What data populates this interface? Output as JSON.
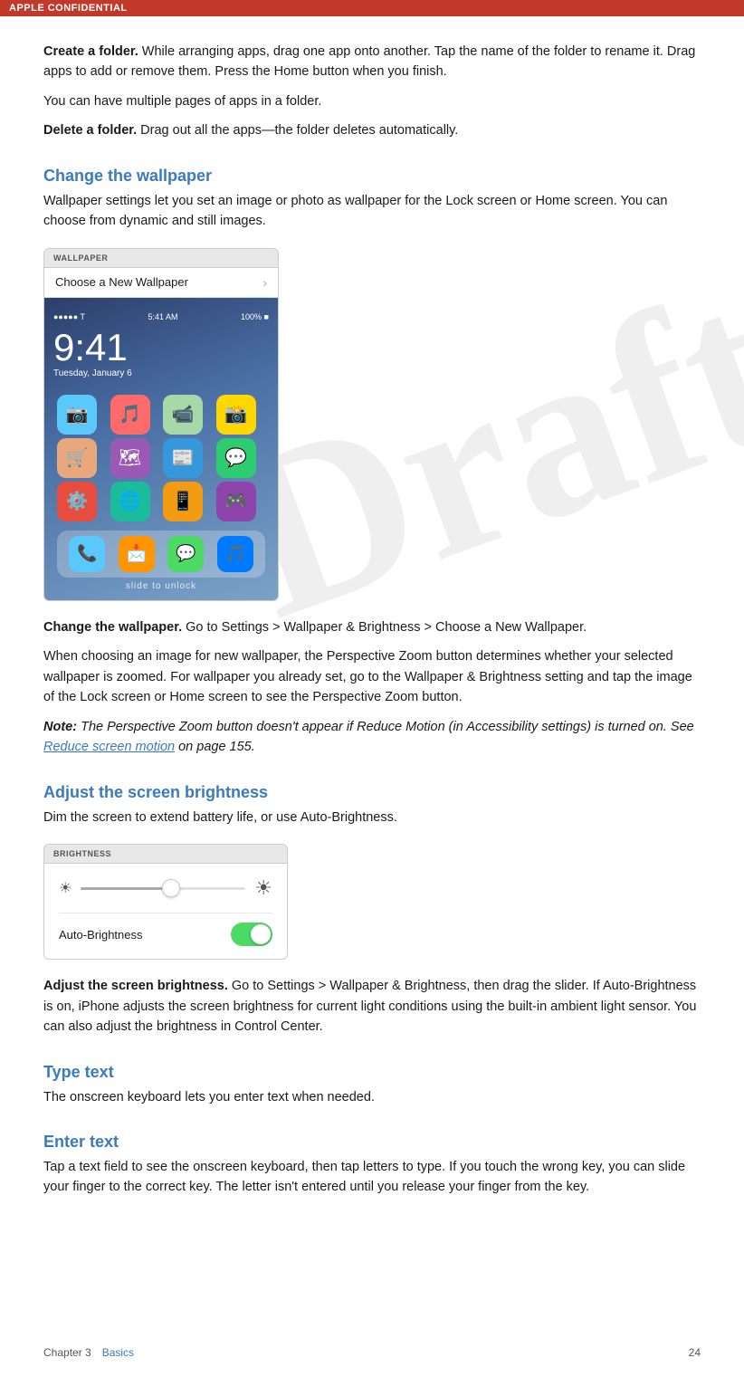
{
  "topBar": {
    "label": "APPLE CONFIDENTIAL"
  },
  "draft": {
    "watermark": "Draft"
  },
  "sections": {
    "createFolder": {
      "heading_bold": "Create a folder.",
      "text": " While arranging apps, drag one app onto another. Tap the name of the folder to rename it. Drag apps to add or remove them. Press the Home button when you finish."
    },
    "createFolder2": {
      "text": "You can have multiple pages of apps in a folder."
    },
    "deleteFolder": {
      "heading_bold": "Delete a folder.",
      "text": " Drag out all the apps—the folder deletes automatically."
    },
    "changeWallpaper": {
      "heading": "Change the wallpaper",
      "body": "Wallpaper settings let you set an image or photo as wallpaper for the Lock screen or Home screen. You can choose from dynamic and still images."
    },
    "wallpaperMockup": {
      "topBarLabel": "WALLPAPER",
      "listItem": "Choose a New Wallpaper",
      "time": "9:41",
      "date": "Tuesday, January 6",
      "slideUnlock": "slide to unlock"
    },
    "changeWallpaperInstruction": {
      "heading_bold": "Change the wallpaper.",
      "text": " Go to Settings > Wallpaper & Brightness > Choose a New Wallpaper."
    },
    "changeWallpaperDetail": {
      "text": "When choosing an image for new wallpaper, the Perspective Zoom button determines whether your selected wallpaper is zoomed. For wallpaper you already set, go to the Wallpaper & Brightness setting and tap the image of the Lock screen or Home screen to see the Perspective Zoom button."
    },
    "note": {
      "bold": "Note:",
      "text": "  The Perspective Zoom button doesn't appear if Reduce Motion (in Accessibility settings) is turned on. See ",
      "link": "Reduce screen motion",
      "linkSuffix": " on page 155."
    },
    "adjustBrightness": {
      "heading": "Adjust the screen brightness",
      "body": "Dim the screen to extend battery life, or use Auto-Brightness."
    },
    "brightnessMockup": {
      "topBarLabel": "BRIGHTNESS",
      "autoLabel": "Auto-Brightness"
    },
    "adjustBrightnessInstruction": {
      "bold": "Adjust the screen brightness.",
      "text": " Go to Settings > Wallpaper & Brightness, then drag the slider. If Auto-Brightness is on, iPhone adjusts the screen brightness for current light conditions using the built-in ambient light sensor. You can also adjust the brightness in Control Center."
    },
    "typeText": {
      "heading": "Type text",
      "body": "The onscreen keyboard lets you enter text when needed."
    },
    "enterText": {
      "heading": "Enter text",
      "body": "Tap a text field to see the onscreen keyboard, then tap letters to type. If you touch the wrong key, you can slide your finger to the correct key. The letter isn't entered until you release your finger from the key."
    }
  },
  "footer": {
    "chapterLabel": "Chapter  3",
    "sectionLabel": "Basics",
    "pageNumber": "24"
  }
}
